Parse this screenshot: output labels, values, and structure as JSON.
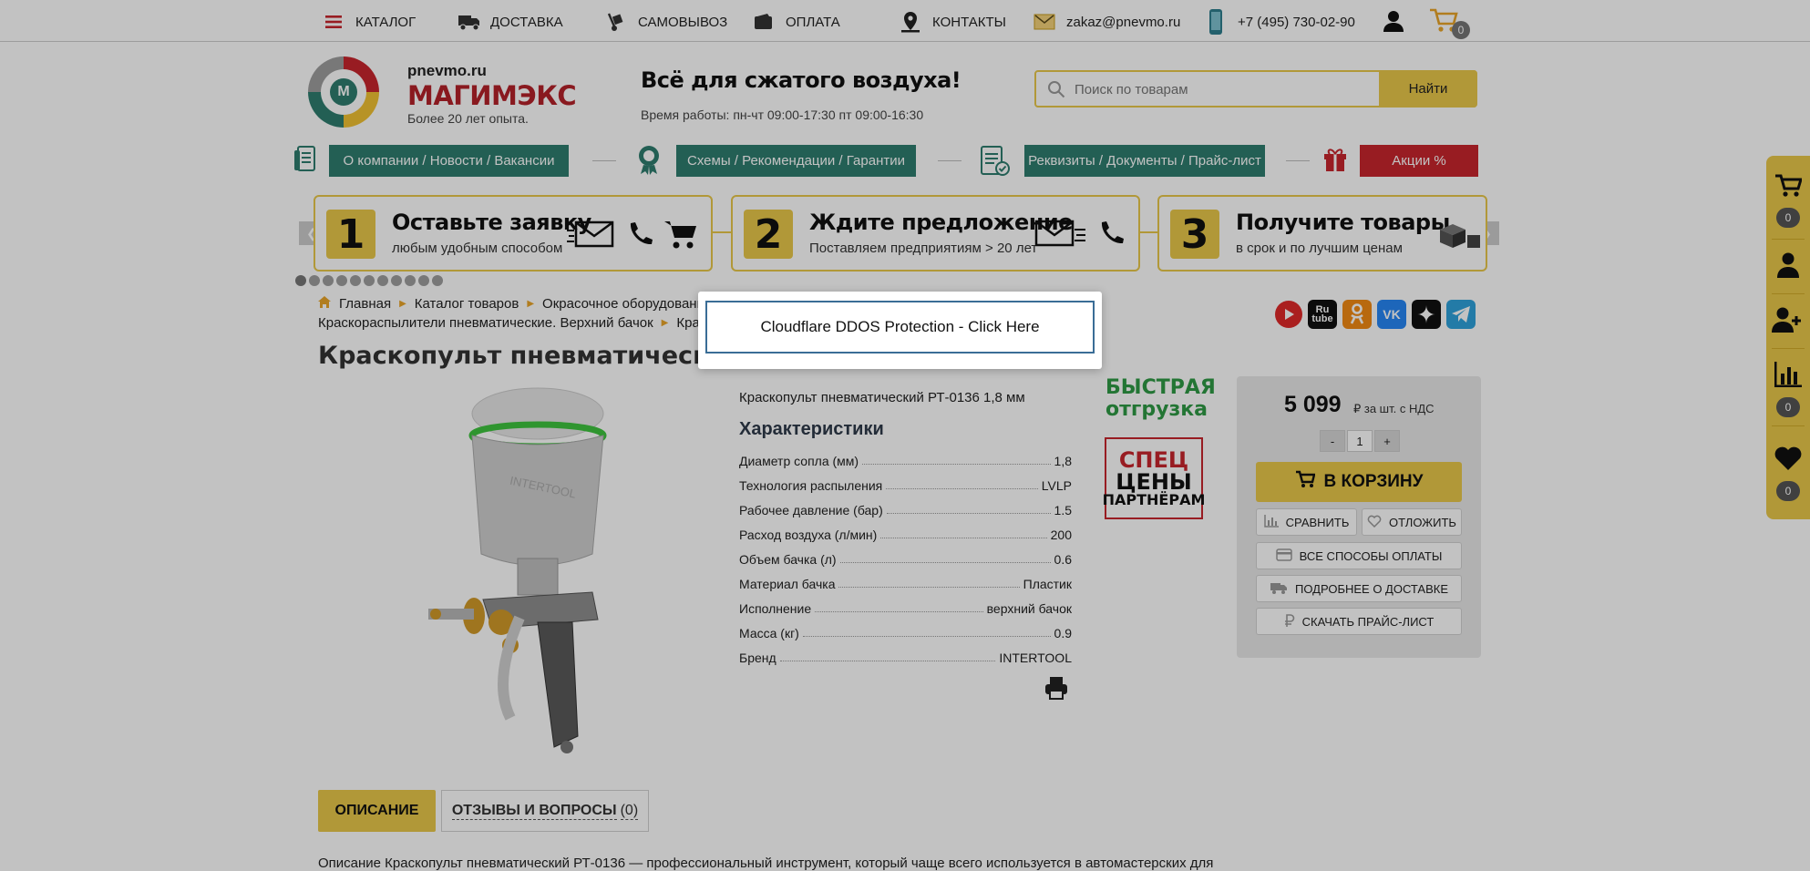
{
  "topbar": {
    "catalog": "КАТАЛОГ",
    "delivery": "ДОСТАВКА",
    "pickup": "САМОВЫВОЗ",
    "payment": "ОПЛАТА",
    "contacts": "КОНТАКТЫ",
    "email": "zakaz@pnevmo.ru",
    "phone": "+7 (495) 730-02-90",
    "cart_count": "0"
  },
  "header": {
    "domain": "pnevmo.ru",
    "brand": "МАГИМЭКС",
    "tagline": "Более 20 лет опыта.",
    "slogan": "Всё для сжатого воздуха!",
    "hours": "Время работы: пн-чт 09:00-17:30 пт 09:00-16:30",
    "search_placeholder": "Поиск по товарам",
    "search_button": "Найти"
  },
  "nav": {
    "about": "О компании / Новости / Вакансии",
    "schemes": "Схемы / Рекомендации / Гарантии",
    "docs": "Реквизиты / Документы / Прайс-лист",
    "promo": "Акции %"
  },
  "steps": [
    {
      "num": "1",
      "title": "Оставьте заявку",
      "sub": "любым удобным способом"
    },
    {
      "num": "2",
      "title": "Ждите предложение",
      "sub": "Поставляем предприятиям > 20 лет"
    },
    {
      "num": "3",
      "title": "Получите товары",
      "sub": "в срок и по лучшим ценам"
    }
  ],
  "breadcrumbs": {
    "home": "Главная",
    "catalog": "Каталог товаров",
    "painting": "Окрасочное оборудование",
    "sprayers": "Краскораспылители пневматические. Верхний бачок",
    "partial": "Крас"
  },
  "product": {
    "title": "Краскопульт пневматический Р",
    "subtitle": "Краскопульт пневматический РТ-0136 1,8 мм",
    "characteristics_heading": "Характеристики",
    "specs": [
      {
        "label": "Диаметр сопла (мм)",
        "value": "1,8"
      },
      {
        "label": "Технология распыления",
        "value": "LVLP"
      },
      {
        "label": "Рабочее давление (бар)",
        "value": "1.5"
      },
      {
        "label": "Расход воздуха (л/мин)",
        "value": "200"
      },
      {
        "label": "Объем бачка (л)",
        "value": "0.6"
      },
      {
        "label": "Материал бачка",
        "value": "Пластик"
      },
      {
        "label": "Исполнение",
        "value": "верхний бачок"
      },
      {
        "label": "Масса (кг)",
        "value": "0.9"
      },
      {
        "label": "Бренд",
        "value": "INTERTOOL"
      }
    ],
    "fast_line1": "БЫСТРАЯ",
    "fast_line2": "отгрузка",
    "badge_line1": "СПЕЦ",
    "badge_line2": "ЦЕНЫ",
    "badge_line3": "ПАРТНЁРАМ",
    "image_brand": "INTERTOOL"
  },
  "buybox": {
    "price": "5 099",
    "price_unit": "₽ за шт. с НДС",
    "qty_minus": "-",
    "qty_value": "1",
    "qty_plus": "+",
    "cart_button": "В КОРЗИНУ",
    "compare": "СРАВНИТЬ",
    "defer": "ОТЛОЖИТЬ",
    "payment_methods": "ВСЕ СПОСОБЫ ОПЛАТЫ",
    "delivery_info": "ПОДРОБНЕЕ О ДОСТАВКЕ",
    "price_list": "СКАЧАТЬ ПРАЙС-ЛИСТ"
  },
  "social": {
    "rutube": "Ru tube"
  },
  "tabs": {
    "description": "ОПИСАНИЕ",
    "reviews": "ОТЗЫВЫ И ВОПРОСЫ",
    "reviews_count": "(0)"
  },
  "description_text": "Описание Краскопульт пневматический РТ-0136 — профессиональный инструмент, который чаще всего используется в автомастерских для",
  "sidepanel": {
    "cart_count": "0",
    "compare_count": "0",
    "favorites_count": "0"
  },
  "modal": {
    "button_label": "Cloudflare DDOS Protection - Click Here"
  },
  "colors": {
    "accent_yellow": "#e9c84a",
    "nav_teal": "#2e7d6f",
    "promo_red": "#c8262d",
    "fast_green": "#2f9a45"
  }
}
